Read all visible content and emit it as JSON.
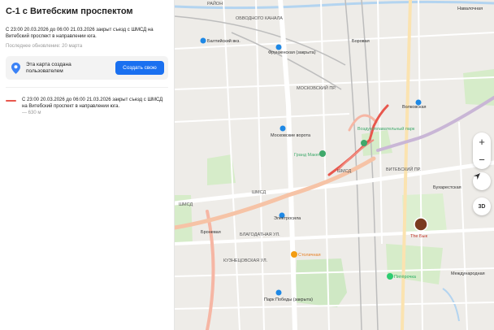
{
  "panel": {
    "title": "С-1 с Витебским проспектом",
    "description": "С 23:00 20.03.2026 до 06:00 21.03.2026 закрыт съезд с ШМСД на Витебский проспект в направлении юга.",
    "updated": "Последнее обновление: 20 марта",
    "user_box_text": "Эта карта создана пользователем",
    "create_button": "Создать свою",
    "route": {
      "text": "С 23:00 20.03.2026 до 06:00 21.03.2026 закрыт съезд с ШМСД на Витебский проспект в направлении юга.",
      "length": "— 630 м",
      "color": "#e8574d"
    }
  },
  "map": {
    "labels": {
      "rayon": "РАЙОН",
      "obvodny": "ОБВОДНОГО КАНАЛА",
      "baltiysky": "Балтийский вкз.",
      "frunzenskaya": "Фрунзенская (закрыта)",
      "borovaya": "Боровая",
      "navalochnaya": "Навалочная",
      "volkovskaya": "Волковская",
      "moskovskie_vorota": "Московские ворота",
      "grand_maket": "Гранд Макет",
      "vozdukhoplavatelny": "Воздухоплавательный парк",
      "elektrosila": "Электросила",
      "buharestskaya": "Бухарестская",
      "bronevaya": "Броневая",
      "the_bike": "The Бык",
      "stolichnaya": "Столичная",
      "pyaterochka": "Пятёрочка",
      "park_pobedy": "Парк Победы (закрыта)",
      "mezhdunarodnaya": "Международная",
      "shmsd1": "ШМСД",
      "shmsd2": "ШМСД",
      "shmsd3": "ШМСД",
      "blagodatnaya": "БЛАГОДАТНАЯ УЛ.",
      "kuznetsovskaya": "КУЗНЕЦОВСКАЯ УЛ.",
      "vitebsky": "ВИТЕБСКИЙ ПР.",
      "moskovsky": "МОСКОВСКИЙ ПР."
    },
    "zoom_in": "+",
    "zoom_out": "−",
    "mode_3d": "3D"
  }
}
